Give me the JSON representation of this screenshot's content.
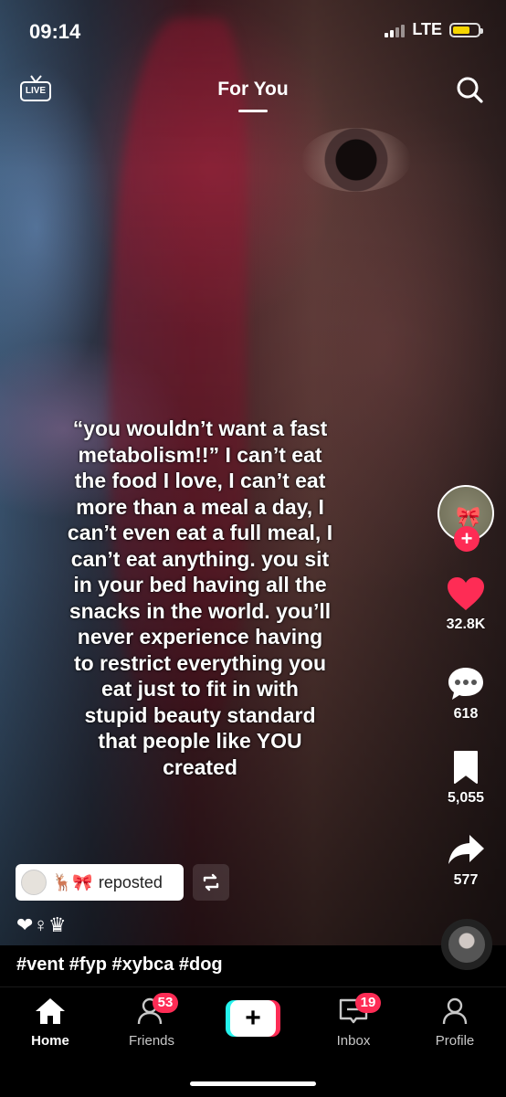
{
  "status_bar": {
    "time": "09:14",
    "network": "LTE",
    "battery_color": "#f5d500"
  },
  "top_nav": {
    "live_label": "LIVE",
    "title": "For You"
  },
  "caption": {
    "text": "“you wouldn’t want a fast\nmetabolism!!” I can’t eat\nthe food I love, I can’t eat\nmore than a meal a day, I\ncan’t even eat a full meal, I\ncan’t eat anything. you sit\nin your bed having all the\nsnacks in the world. you’ll\nnever experience having\nto restrict everything you\neat just to fit in with\nstupid beauty standard\nthat people like YOU\ncreated"
  },
  "actions": {
    "likes": "32.8K",
    "comments": "618",
    "saves": "5,055",
    "shares": "577",
    "like_color": "#fe2c55"
  },
  "repost": {
    "emoji": "🦌🎀",
    "label": "reposted"
  },
  "profile_symbols": "❤♀♛",
  "hashtags": "#vent #fyp #xybca #dog",
  "bottom_nav": {
    "home": "Home",
    "friends": "Friends",
    "friends_badge": "53",
    "create": "+",
    "inbox": "Inbox",
    "inbox_badge": "19",
    "profile": "Profile"
  },
  "accent_colors": {
    "brand_red": "#fe2c55",
    "brand_cyan": "#25f4ee"
  }
}
